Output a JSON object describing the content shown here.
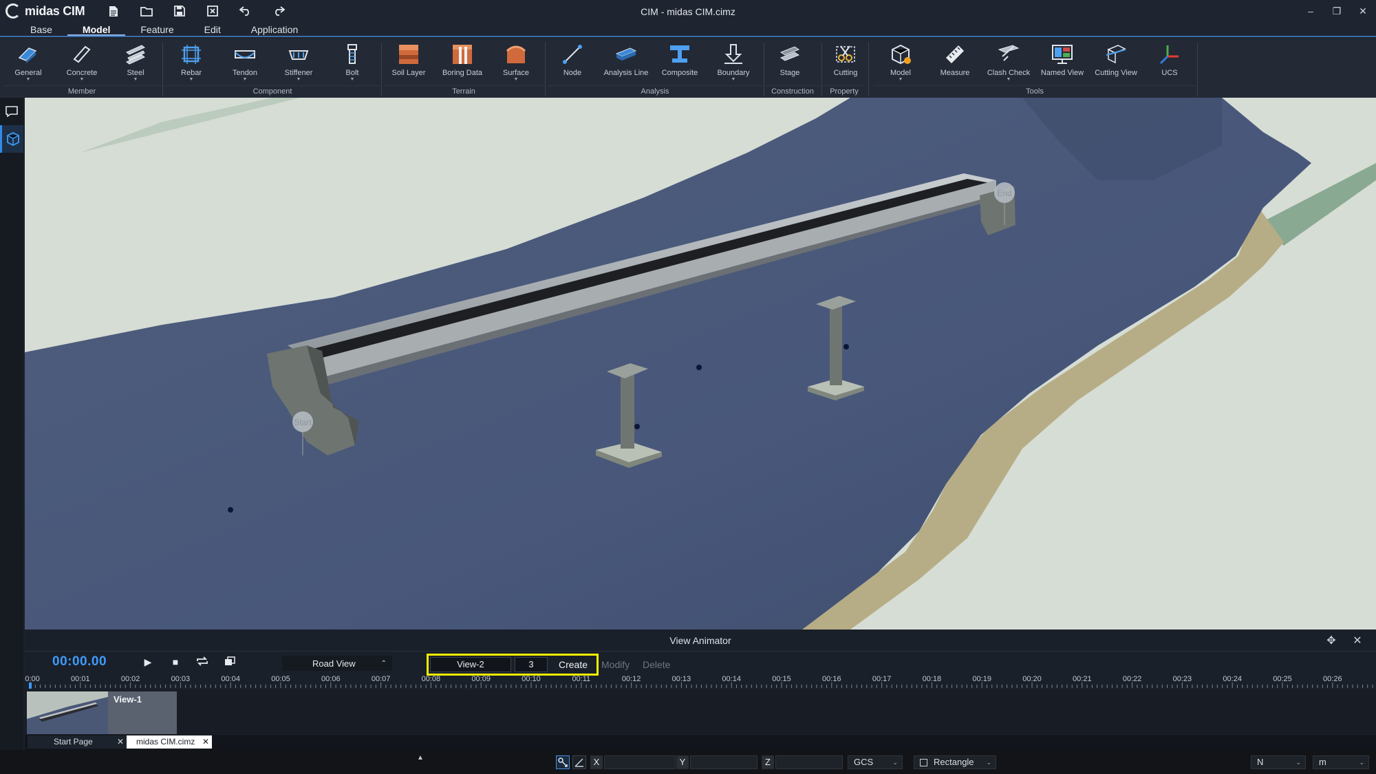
{
  "app": {
    "logo_text": "midas CIM",
    "window_title": "CIM - midas CIM.cimz"
  },
  "menu": {
    "tabs": [
      {
        "label": "Base"
      },
      {
        "label": "Model"
      },
      {
        "label": "Feature"
      },
      {
        "label": "Edit"
      },
      {
        "label": "Application"
      }
    ]
  },
  "ribbon": {
    "buttons": [
      {
        "label": "General",
        "icon": "general-icon"
      },
      {
        "label": "Concrete",
        "icon": "concrete-icon"
      },
      {
        "label": "Steel",
        "icon": "steel-icon"
      },
      {
        "label": "Rebar",
        "icon": "rebar-icon"
      },
      {
        "label": "Tendon",
        "icon": "tendon-icon"
      },
      {
        "label": "Stiffener",
        "icon": "stiffener-icon"
      },
      {
        "label": "Bolt",
        "icon": "bolt-icon"
      },
      {
        "label": "Soil Layer",
        "icon": "soil-layer-icon"
      },
      {
        "label": "Boring Data",
        "icon": "boring-data-icon"
      },
      {
        "label": "Surface",
        "icon": "surface-icon"
      },
      {
        "label": "Node",
        "icon": "node-icon"
      },
      {
        "label": "Analysis Line",
        "icon": "analysis-line-icon"
      },
      {
        "label": "Composite",
        "icon": "composite-icon"
      },
      {
        "label": "Boundary",
        "icon": "boundary-icon"
      },
      {
        "label": "Stage",
        "icon": "stage-icon"
      },
      {
        "label": "Cutting",
        "icon": "cutting-icon"
      },
      {
        "label": "Model",
        "icon": "model-icon"
      },
      {
        "label": "Measure",
        "icon": "measure-icon"
      },
      {
        "label": "Clash Check",
        "icon": "clash-check-icon"
      },
      {
        "label": "Named View",
        "icon": "named-view-icon"
      },
      {
        "label": "Cutting View",
        "icon": "cutting-view-icon"
      },
      {
        "label": "UCS",
        "icon": "ucs-icon"
      }
    ],
    "groups": [
      {
        "label": "Member"
      },
      {
        "label": "Component"
      },
      {
        "label": "Terrain"
      },
      {
        "label": "Analysis"
      },
      {
        "label": "Construction"
      },
      {
        "label": "Property"
      },
      {
        "label": "Tools"
      }
    ]
  },
  "viewport": {
    "start_marker": "Start",
    "end_marker": "End"
  },
  "animator": {
    "title": "View Animator",
    "timecode": "00:00.00",
    "view_mode": "Road View",
    "new_view_name": "View-2",
    "duration": "3",
    "create_label": "Create",
    "modify_label": "Modify",
    "delete_label": "Delete",
    "ticks": [
      "00:00",
      "00:01",
      "00:02",
      "00:03",
      "00:04",
      "00:05",
      "00:06",
      "00:07",
      "00:08",
      "00:09",
      "00:10",
      "00:11",
      "00:12",
      "00:13",
      "00:14",
      "00:15",
      "00:16",
      "00:17",
      "00:18",
      "00:19",
      "00:20",
      "00:21",
      "00:22",
      "00:23",
      "00:24",
      "00:25",
      "00:26"
    ],
    "clips": [
      {
        "label": "View-1"
      }
    ]
  },
  "doc_tabs": [
    {
      "label": "Start Page"
    },
    {
      "label": "midas CIM.cimz"
    }
  ],
  "statusbar": {
    "x_label": "X",
    "y_label": "Y",
    "z_label": "Z",
    "coord_system": "GCS",
    "selection_mode": "Rectangle",
    "force_unit": "N",
    "length_unit": "m"
  },
  "colors": {
    "accent": "#3e9bff",
    "highlight": "#f5f000",
    "water": "#4a5a78",
    "land": "#d6ddd5"
  }
}
